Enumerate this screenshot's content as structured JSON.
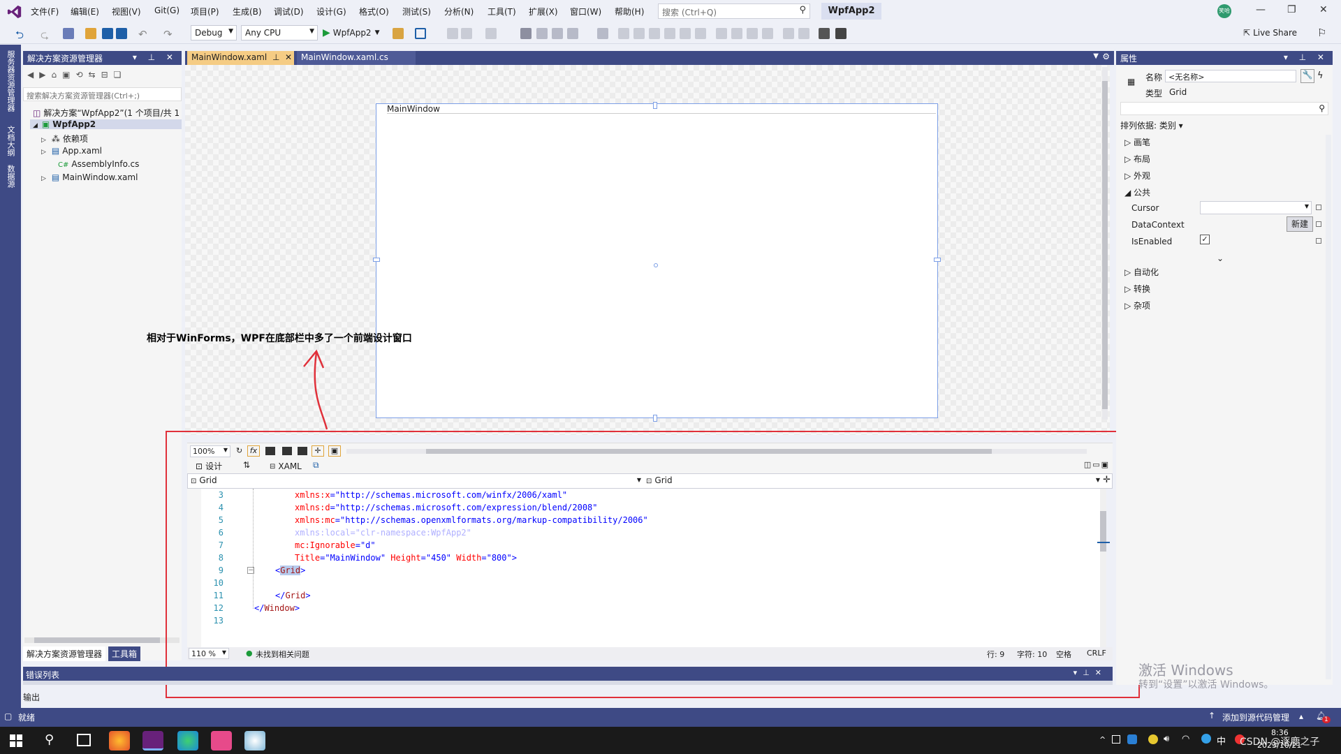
{
  "menu": {
    "items": [
      "文件(F)",
      "编辑(E)",
      "视图(V)",
      "Git(G)",
      "项目(P)",
      "生成(B)",
      "调试(D)",
      "设计(G)",
      "格式(O)",
      "测试(S)",
      "分析(N)",
      "工具(T)",
      "扩展(X)",
      "窗口(W)",
      "帮助(H)"
    ],
    "search_placeholder": "搜索 (Ctrl+Q)",
    "solution_name": "WpfApp2",
    "user_initials": "笑哈"
  },
  "toolbar": {
    "config": "Debug",
    "platform": "Any CPU",
    "run_target": "WpfApp2",
    "live_share": "Live Share"
  },
  "side_tabs": [
    "服务器资源管理器",
    "文档大纲",
    "数据源"
  ],
  "solution_explorer": {
    "title": "解决方案资源管理器",
    "search_placeholder": "搜索解决方案资源管理器(Ctrl+;)",
    "items": [
      "解决方案“WpfApp2”(1 个项目/共 1",
      "WpfApp2",
      "依赖项",
      "App.xaml",
      "AssemblyInfo.cs",
      "MainWindow.xaml"
    ],
    "bottom_tabs": [
      "解决方案资源管理器",
      "工具箱"
    ]
  },
  "doc_tabs": [
    "MainWindow.xaml",
    "MainWindow.xaml.cs"
  ],
  "designer": {
    "window_title": "MainWindow",
    "annotation": "相对于WinForms，WPF在底部栏中多了一个前端设计窗口",
    "zoom": "100%",
    "fx": "fx",
    "tab_design": "设计",
    "tab_xaml": "XAML",
    "left_scope": "Grid",
    "right_scope": "Grid"
  },
  "code": {
    "lines": [
      {
        "n": "3",
        "text": "xmlns:x=\"http://schemas.microsoft.com/winfx/2006/xaml\""
      },
      {
        "n": "4",
        "text": "xmlns:d=\"http://schemas.microsoft.com/expression/blend/2008\""
      },
      {
        "n": "5",
        "text": "xmlns:mc=\"http://schemas.openxmlformats.org/markup-compatibility/2006\""
      },
      {
        "n": "6",
        "text": "xmlns:local=\"clr-namespace:WpfApp2\""
      },
      {
        "n": "7",
        "text": "mc:Ignorable=\"d\""
      },
      {
        "n": "8",
        "text": "Title=\"MainWindow\" Height=\"450\" Width=\"800\">"
      },
      {
        "n": "9",
        "text": "<Grid>"
      },
      {
        "n": "10",
        "text": ""
      },
      {
        "n": "11",
        "text": "</Grid>"
      },
      {
        "n": "12",
        "text": "</Window>"
      },
      {
        "n": "13",
        "text": ""
      }
    ]
  },
  "editor_status": {
    "zoom": "110 %",
    "issues": "未找到相关问题",
    "line": "行: 9",
    "col": "字符: 10",
    "spacing": "空格",
    "eol": "CRLF"
  },
  "bottom_panels": {
    "error_list": "错误列表",
    "output": "输出"
  },
  "properties": {
    "title": "属性",
    "name_label": "名称",
    "name_value": "<无名称>",
    "type_label": "类型",
    "type_value": "Grid",
    "sort_label": "排列依据: 类别",
    "categories_top": [
      "画笔",
      "布局",
      "外观",
      "公共"
    ],
    "common_props": [
      {
        "name": "Cursor"
      },
      {
        "name": "DataContext",
        "button": "新建"
      },
      {
        "name": "IsEnabled"
      }
    ],
    "categories_bottom": [
      "自动化",
      "转换",
      "杂项"
    ]
  },
  "statusbar": {
    "ready": "就绪",
    "source_control": "添加到源代码管理",
    "notifications": "1"
  },
  "watermark": {
    "line1": "激活 Windows",
    "line2": "转到“设置”以激活 Windows。"
  },
  "taskbar": {
    "ime": "中",
    "time": "8:36",
    "date": "2023/10/21",
    "credit": "CSDN @逐鹿之子"
  },
  "colors": {
    "accent": "#3e4a85",
    "annotation_box": "#e0303a",
    "vs_purple": "#68217a"
  }
}
